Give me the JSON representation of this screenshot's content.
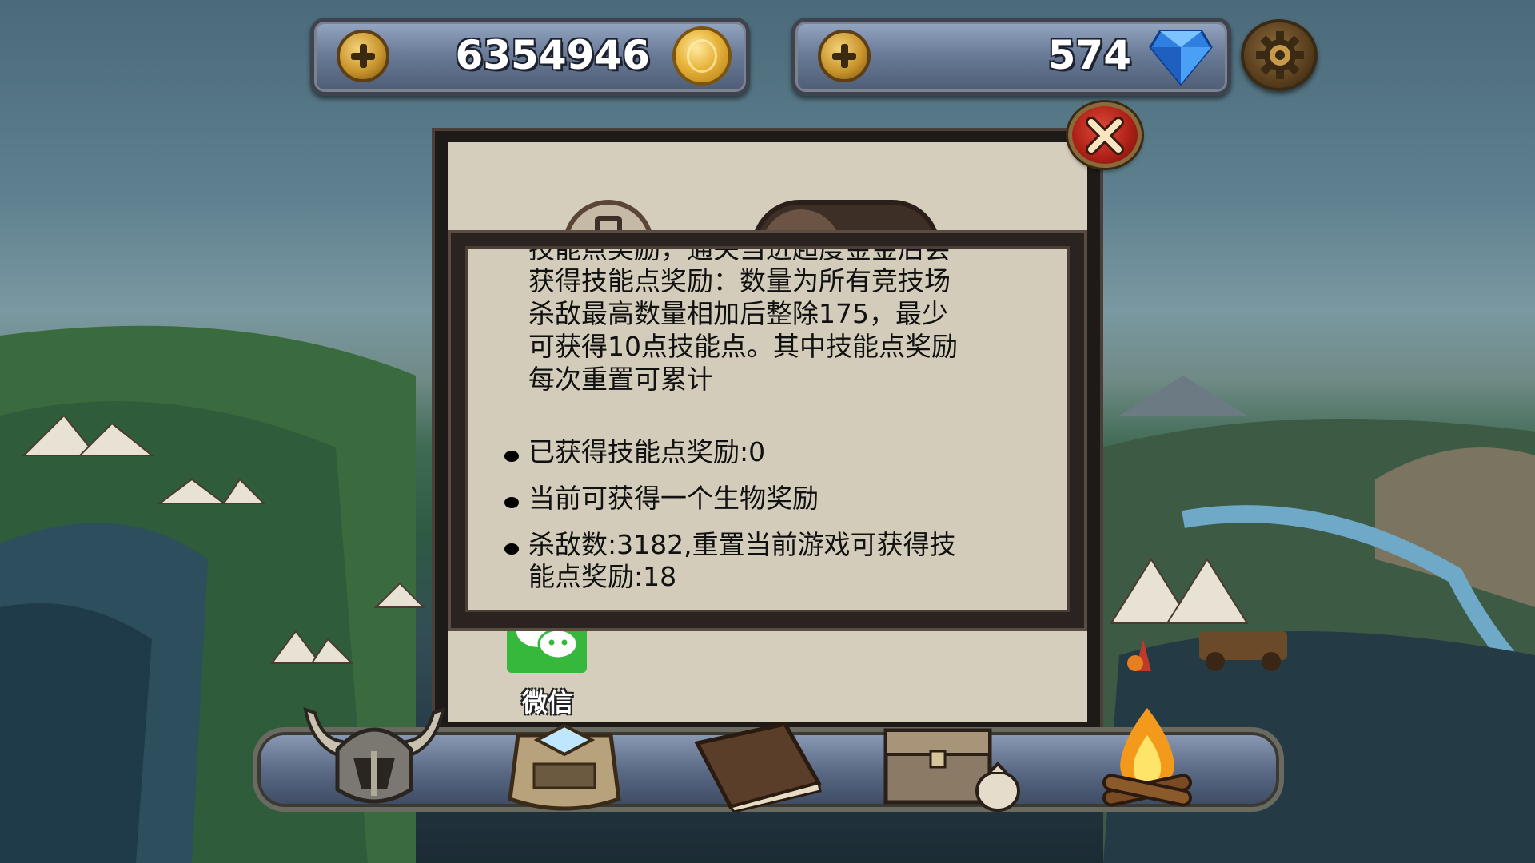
{
  "currency": {
    "gold": {
      "value": "6354946",
      "icon": "gold-coin-icon",
      "add_icon": "plus-icon"
    },
    "gems": {
      "value": "574",
      "icon": "blue-diamond-icon",
      "add_icon": "plus-icon"
    }
  },
  "settings": {
    "icon": "gear-icon"
  },
  "dialog": {
    "close_icon": "close-x-icon",
    "tabs": [
      {
        "icon": "tab-left-icon"
      },
      {
        "icon": "tab-right-icon"
      }
    ],
    "info_lines": [
      "技能点奖励，通关当进超度金金后会",
      "获得技能点奖励：数量为所有竞技场",
      "杀敌最高数量相加后整除175，最少",
      "可获得10点技能点。其中技能点奖励",
      "每次重置可累计"
    ],
    "bullets": [
      "已获得技能点奖励:0",
      "当前可获得一个生物奖励",
      "杀敌数:3182,重置当前游戏可获得技",
      "能点奖励:18"
    ],
    "share": {
      "wechat_label": "微信",
      "icon": "wechat-icon"
    }
  },
  "bottom_bar": {
    "items": [
      "helmet-icon",
      "hero-card-icon",
      "book-icon",
      "chest-icon",
      "campfire-icon"
    ]
  },
  "colors": {
    "dialog_bg": "#d6cebd",
    "dialog_frame": "#1e1a17",
    "close_red": "#b02218",
    "currency_bar": "#6a7c98",
    "wechat_green": "#35b83c"
  }
}
